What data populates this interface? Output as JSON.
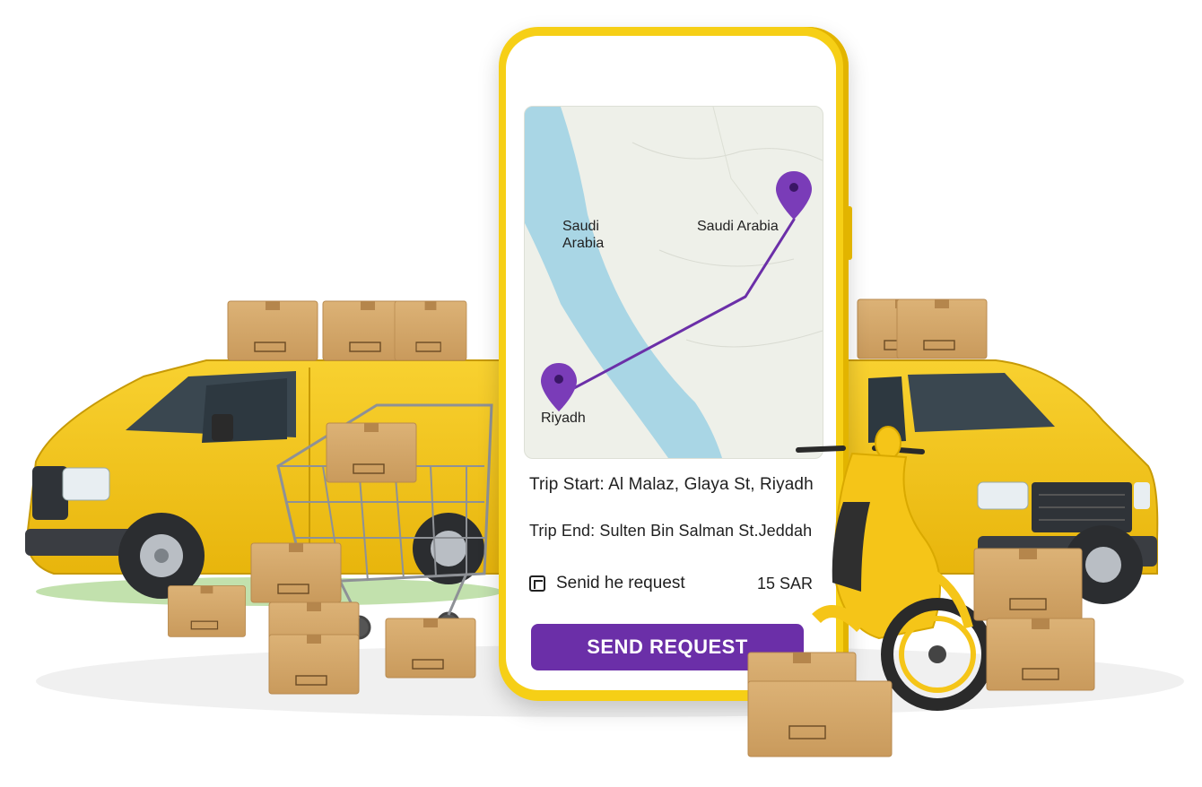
{
  "map": {
    "label_region": "Saudi Arabia",
    "label_destination": "Saudi Arabia",
    "label_origin": "Riyadh",
    "route_color": "#6b2fa8",
    "water_color": "#a9d6e5",
    "land_color": "#eef0e9",
    "pin_icon": "map-pin-icon"
  },
  "trip": {
    "start_label": "Trip Start:",
    "start_value": "Al Malaz, Glaya St, Riyadh",
    "end_label": "Trip End:",
    "end_value": "Sulten Bin Salman St.Jeddah"
  },
  "request": {
    "icon": "document-icon",
    "text": "Senid he request",
    "price": "15 SAR"
  },
  "button": {
    "label": "SEND REQUEST",
    "color": "#6b2fa8"
  },
  "scene": {
    "vehicle_color": "#f5c518",
    "box_color": "#d4a86a",
    "illustrations": [
      "delivery-van-left-icon",
      "delivery-van-right-icon",
      "shopping-cart-icon",
      "scooter-icon",
      "cardboard-box-icon"
    ]
  }
}
